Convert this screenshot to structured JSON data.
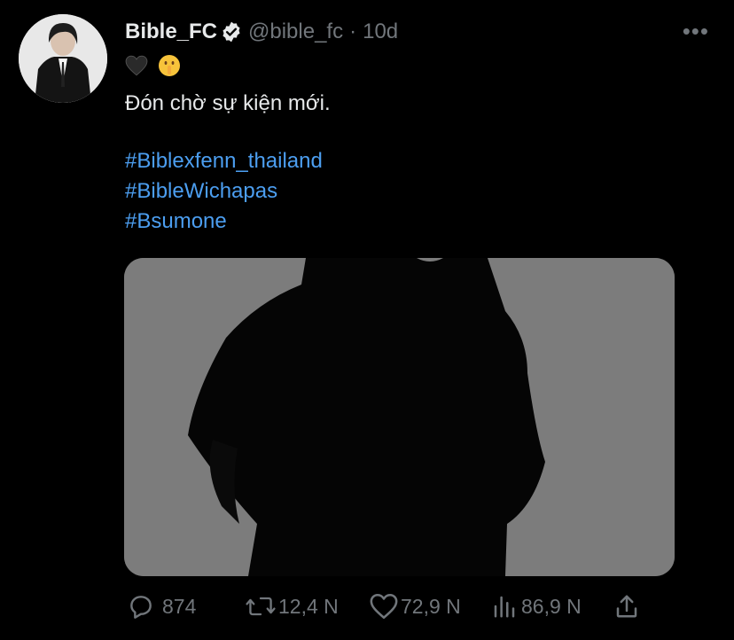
{
  "tweet": {
    "author_name": "Bible_FC",
    "handle": "@bible_fc",
    "separator": "·",
    "time": "10d",
    "emojis": [
      "🖤",
      "🤫"
    ],
    "text": "Đón chờ sự kiện mới.",
    "hashtags": [
      "#Biblexfenn_thailand",
      "#BibleWichapas",
      "#Bsumone"
    ]
  },
  "actions": {
    "replies": "874",
    "retweets": "12,4 N",
    "likes": "72,9 N",
    "views": "86,9 N"
  },
  "icons": {
    "verified": "verified-badge-icon",
    "more": "more-icon",
    "reply": "reply-icon",
    "retweet": "retweet-icon",
    "like": "like-icon",
    "views": "views-icon",
    "share": "share-icon"
  }
}
